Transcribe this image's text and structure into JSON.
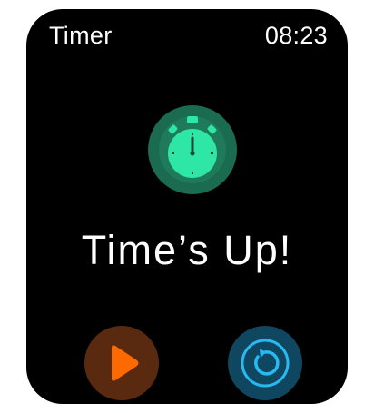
{
  "header": {
    "app_title": "Timer",
    "time": "08:23"
  },
  "main": {
    "icon": "stopwatch-icon",
    "message": "Time’s Up!"
  },
  "controls": {
    "play": {
      "icon": "play-icon",
      "color": "#ff6a00",
      "bg": "#5a2a10"
    },
    "restart": {
      "icon": "restart-icon",
      "color": "#27b9f2",
      "bg": "#0f4660"
    }
  },
  "colors": {
    "accent_green": "#2ee6a5",
    "badge_bg": "#1a6b4f",
    "background": "#000000"
  }
}
